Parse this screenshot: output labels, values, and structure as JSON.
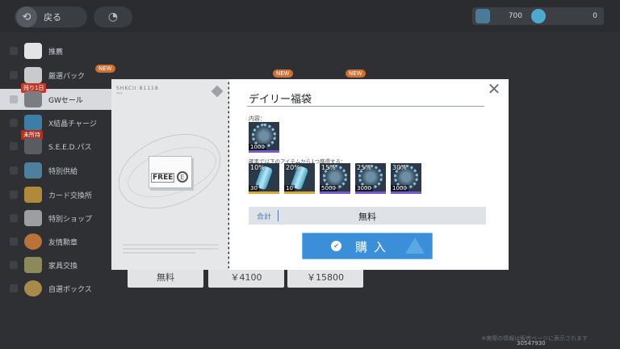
{
  "header": {
    "back_label": "戻る",
    "currencies": [
      {
        "icon": "bottle-currency-icon",
        "value": "700"
      },
      {
        "icon": "crystal-currency-icon",
        "value": "0"
      }
    ]
  },
  "sidebar": {
    "items": [
      {
        "label": "推薦",
        "icon": "cat-icon"
      },
      {
        "label": "厳選パック",
        "icon": "pack-icon",
        "badge": "NEW"
      },
      {
        "label": "GWセール",
        "icon": "sale-icon",
        "tag": "残り1日",
        "active": true
      },
      {
        "label": "X結晶チャージ",
        "icon": "crystal-icon"
      },
      {
        "label": "S.E.E.D.パス",
        "icon": "pass-icon",
        "tag": "未所持"
      },
      {
        "label": "特別供給",
        "icon": "bottle-icon"
      },
      {
        "label": "カード交換所",
        "icon": "card-icon"
      },
      {
        "label": "特別ショップ",
        "icon": "shop-icon"
      },
      {
        "label": "友情勲章",
        "icon": "medal-icon"
      },
      {
        "label": "家具交換",
        "icon": "furniture-icon"
      },
      {
        "label": "自選ボックス",
        "icon": "box-icon"
      }
    ]
  },
  "background": {
    "new_badges": [
      "NEW",
      "NEW"
    ],
    "prices": [
      "無料",
      "￥4100",
      "￥15800"
    ],
    "footer_note": "※実際の情報は販売ページに表示されます",
    "user_id": "30547930"
  },
  "modal": {
    "serial": "SHKCII 81118",
    "serial_sub": "***",
    "box_text": "FREE",
    "box_logo": "E",
    "title": "デイリー福袋",
    "contents_label": "内容：",
    "fixed_items": [
      {
        "qty": "1000",
        "kind": "coin"
      }
    ],
    "random_label": "確率で以下のアイテムから1つ獲得する：",
    "random_items": [
      {
        "pct": "10%",
        "qty": "30",
        "kind": "bottle"
      },
      {
        "pct": "20%",
        "qty": "10",
        "kind": "bottle"
      },
      {
        "pct": "15%",
        "qty": "5000",
        "kind": "coin"
      },
      {
        "pct": "25%",
        "qty": "3000",
        "kind": "coin"
      },
      {
        "pct": "30%",
        "qty": "1000",
        "kind": "coin"
      }
    ],
    "total_label": "合計",
    "total_value": "無料",
    "buy_label": "購入",
    "close_icon": "close-icon"
  },
  "colors": {
    "accent": "#3a8fd8",
    "overlay": "#2e3033",
    "tile_bg": "#2c3948",
    "rarity_purple": "#7a5acb",
    "rarity_gold": "#d8a830"
  }
}
